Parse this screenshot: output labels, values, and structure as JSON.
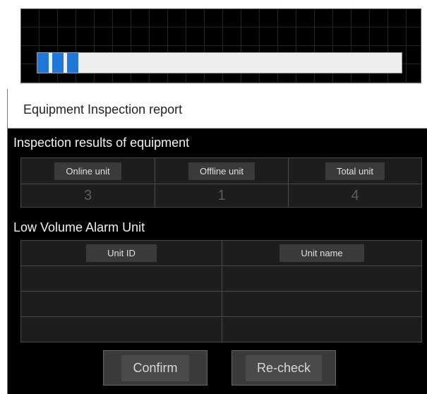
{
  "progress": {
    "fraction": 0.12
  },
  "report": {
    "title": "Equipment Inspection report",
    "results_heading": "Inspection results of equipment",
    "results_table": {
      "headers": [
        "Online unit",
        "Offline unit",
        "Total unit"
      ],
      "values": [
        "3",
        "1",
        "4"
      ]
    },
    "alarm_heading": "Low Volume Alarm Unit",
    "alarm_table": {
      "headers": [
        "Unit ID",
        "Unit name"
      ],
      "rows": [
        [
          "",
          ""
        ],
        [
          "",
          ""
        ],
        [
          "",
          ""
        ]
      ]
    },
    "buttons": {
      "confirm": "Confirm",
      "recheck": "Re-check"
    }
  }
}
